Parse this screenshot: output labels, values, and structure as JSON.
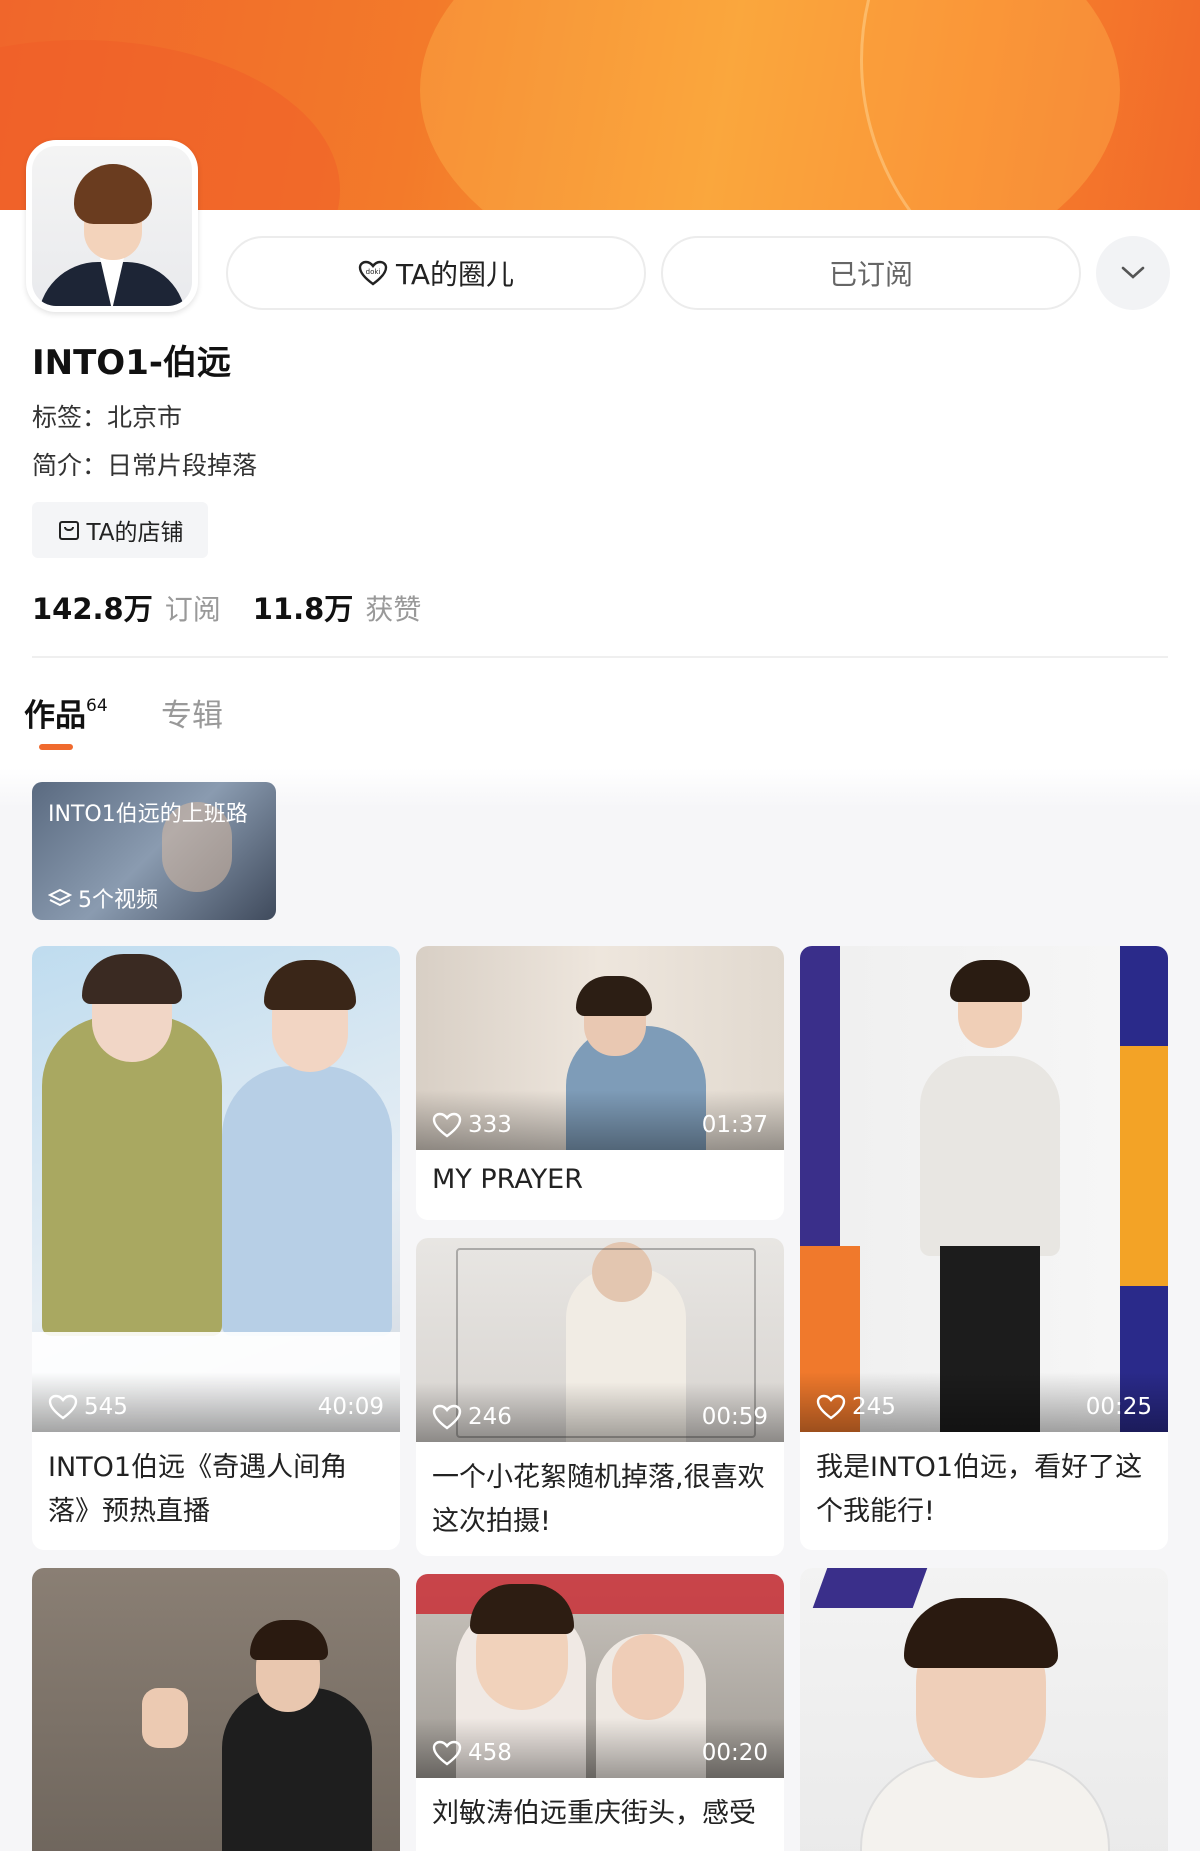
{
  "profile": {
    "circle_label": "TA的圈儿",
    "subscribed_label": "已订阅",
    "name": "INTO1-伯远",
    "tag": "标签：北京市",
    "intro": "简介：日常片段掉落",
    "shop_label": "TA的店铺",
    "subs_num": "142.8万",
    "subs_label": "订阅",
    "likes_num": "11.8万",
    "likes_label": "获赞"
  },
  "tabs": {
    "works_label": "作品",
    "works_count": "64",
    "albums_label": "专辑"
  },
  "collection": {
    "title": "INTO1伯远的上班路",
    "count": "5个视频"
  },
  "videos": [
    {
      "likes": "545",
      "duration": "40:09",
      "caption": "INTO1伯远《奇遇人间角落》预热直播"
    },
    {
      "likes": "333",
      "duration": "01:37",
      "caption": "MY PRAYER"
    },
    {
      "likes": "246",
      "duration": "00:59",
      "caption": "一个小花絮随机掉落,很喜欢这次拍摄!"
    },
    {
      "likes": "245",
      "duration": "00:25",
      "caption": "我是INTO1伯远，看好了这个我能行!"
    },
    {
      "likes": "458",
      "duration": "00:20",
      "caption": "刘敏涛伯远重庆街头，感受"
    }
  ],
  "colors": {
    "accent": "#f06a2e",
    "banner_start": "#f0662b",
    "banner_end": "#f89b33"
  }
}
